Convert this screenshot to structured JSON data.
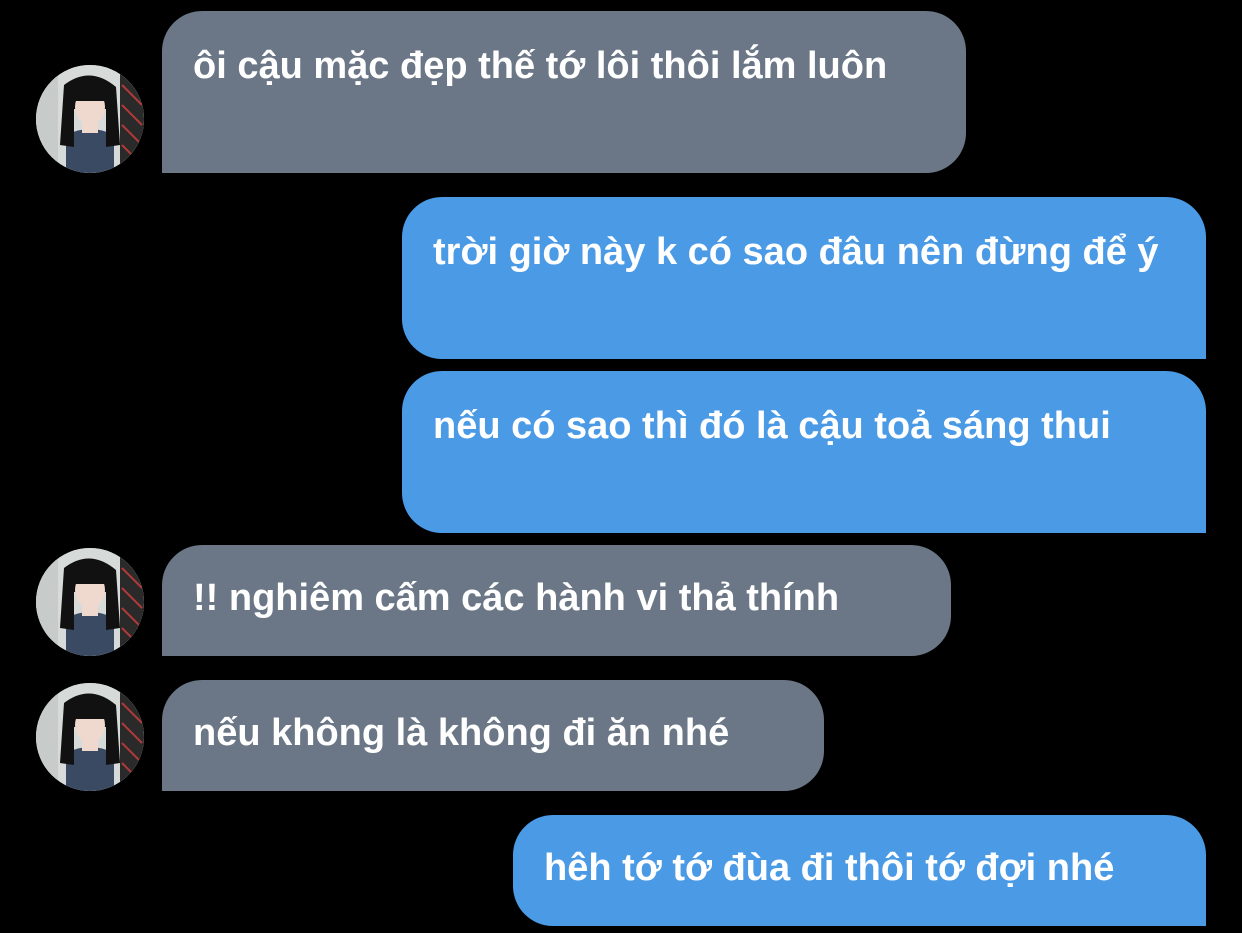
{
  "colors": {
    "background": "#000000",
    "incoming_bubble": "#6b7786",
    "outgoing_bubble": "#4a9ae6",
    "text": "#ffffff"
  },
  "contact": {
    "avatar_icon": "profile-photo-avatar"
  },
  "messages": [
    {
      "direction": "incoming",
      "text": "ôi cậu mặc đẹp thế tớ lôi thôi lắm luôn"
    },
    {
      "direction": "outgoing",
      "text": "trời giờ này k có sao đâu nên đừng để ý"
    },
    {
      "direction": "outgoing",
      "text": "nếu có sao thì đó là cậu toả sáng thui"
    },
    {
      "direction": "incoming",
      "text": "!! nghiêm cấm các hành vi thả thính"
    },
    {
      "direction": "incoming",
      "text": "nếu không là không đi ăn nhé"
    },
    {
      "direction": "outgoing",
      "text": "hêh tớ tớ đùa đi thôi tớ đợi nhé"
    }
  ]
}
